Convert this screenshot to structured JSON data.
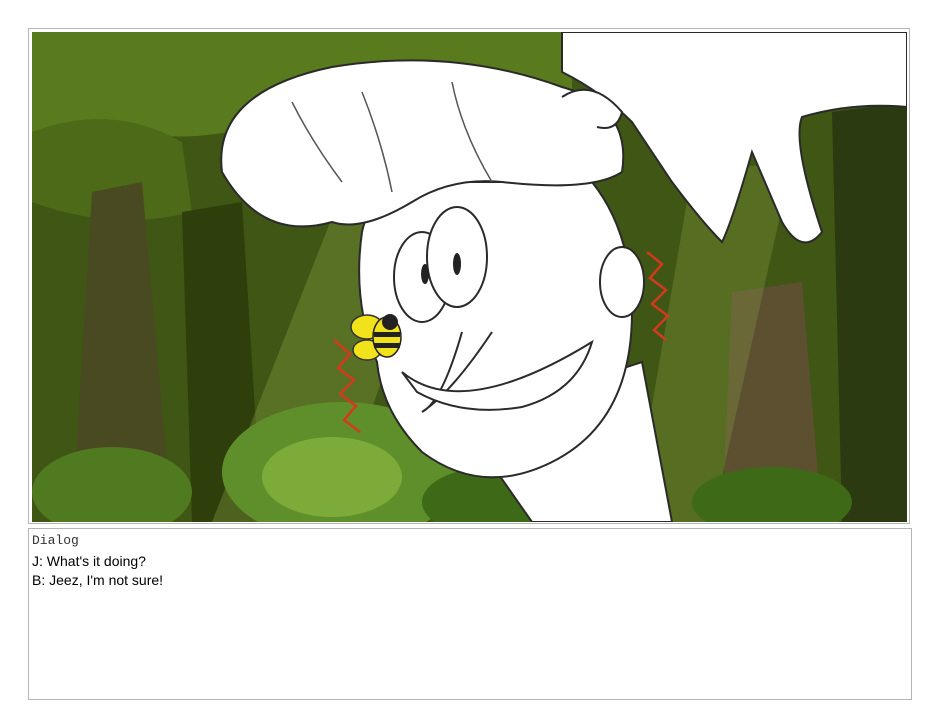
{
  "panel": {
    "image_description_icon": "storyboard-panel-image",
    "colors": {
      "forest_dark": "#2b3a10",
      "forest_mid": "#4a6418",
      "forest_light": "#6f8d2a",
      "trunk_brown": "#5c5030",
      "bee_yellow": "#f2e21b",
      "shock_red": "#d23a1e"
    }
  },
  "dialog": {
    "heading": "Dialog",
    "lines": [
      "J: What's it doing?",
      "B: Jeez, I'm not sure!"
    ]
  }
}
